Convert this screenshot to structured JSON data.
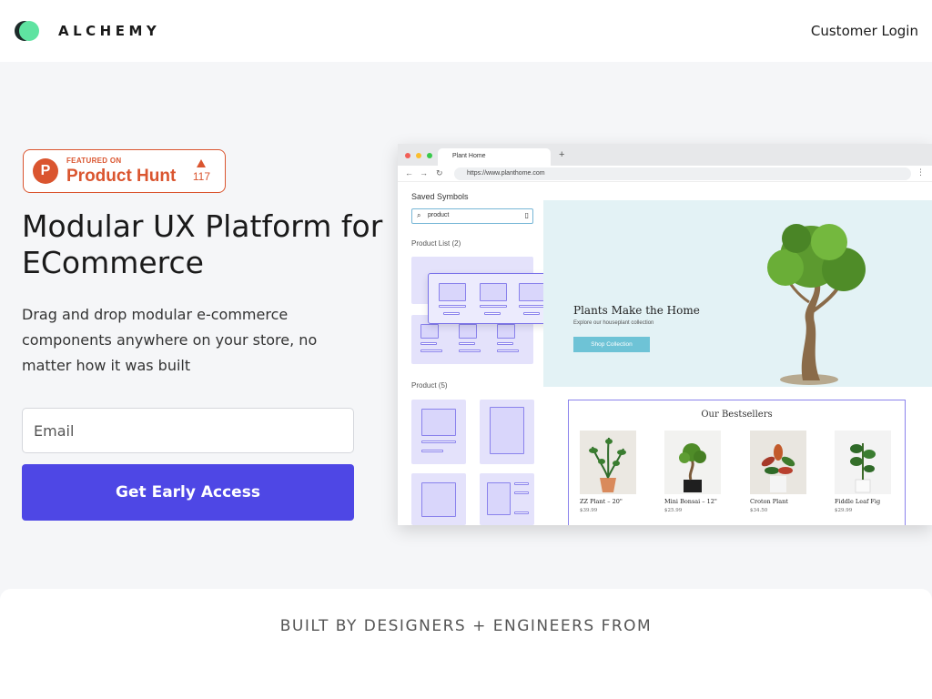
{
  "header": {
    "brand": "ALCHEMY",
    "login_label": "Customer Login"
  },
  "product_hunt": {
    "featured": "FEATURED ON",
    "name": "Product Hunt",
    "votes": "117",
    "letter": "P"
  },
  "hero": {
    "title": "Modular UX Platform for ECommerce",
    "subtitle": "Drag and drop modular e-commerce components anywhere on your store, no matter how it was built",
    "email_placeholder": "Email",
    "cta_label": "Get Early Access"
  },
  "mockup": {
    "tab_title": "Plant Home",
    "url": "https://www.planthome.com",
    "panel_title": "Saved Symbols",
    "search_value": "product",
    "section_1": "Product List (2)",
    "section_2": "Product (5)",
    "banner_title": "Plants Make the Home",
    "banner_sub": "Explore our houseplant collection",
    "banner_button": "Shop Collection",
    "bestsellers_title": "Our Bestsellers",
    "products": [
      {
        "name": "ZZ Plant – 20\"",
        "price": "$39.99"
      },
      {
        "name": "Mini Bonsai – 12\"",
        "price": "$25.99"
      },
      {
        "name": "Croton Plant",
        "price": "$34.50"
      },
      {
        "name": "Fiddle Leaf Fig",
        "price": "$29.99"
      }
    ]
  },
  "built_by": "BUILT BY DESIGNERS + ENGINEERS FROM",
  "colors": {
    "accent": "#4e47e5",
    "product_hunt": "#da552f",
    "logo_green": "#5fe3a1",
    "symbol_purple": "#8a82ec",
    "banner_button": "#6ec3d6"
  }
}
